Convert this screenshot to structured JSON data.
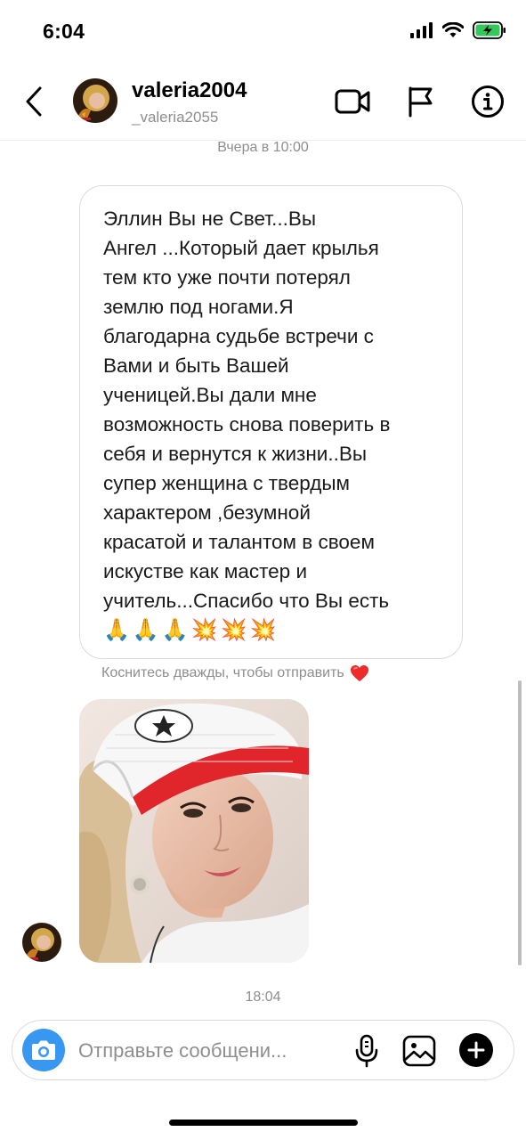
{
  "status_bar": {
    "time": "6:04",
    "icons": [
      "signal-icon",
      "wifi-icon",
      "battery-charging-icon"
    ],
    "battery_color": "#34c759"
  },
  "header": {
    "username": "valeria2004",
    "handle": "_valeria2055",
    "icons": [
      "back-chevron-icon",
      "video-call-icon",
      "flag-icon",
      "info-icon"
    ]
  },
  "thread": {
    "timestamp_top": "Вчера в 10:00",
    "message": {
      "text": "Эллин Вы не Свет...Вы\nАнгел ...Который дает крылья\nтем кто уже почти потерял\nземлю под ногами.Я\nблагодарна судьбе встречи с\nВами и быть Вашей\nученицей.Вы дали мне\nвозможность снова поверить в\nсебя и вернутся к жизни..Вы\nсупер женщина с твердым\nхарактером ,безумной\nкрасатой и талантом в своем\nискустве как мастер и\nучитель...Спасибо что Вы есть",
      "emojis": [
        "🙏",
        "🙏",
        "🙏",
        "💥",
        "💥",
        "💥"
      ]
    },
    "hint": "Коснитесь дважды, чтобы отправить",
    "hint_icon": "heart-icon",
    "photo_icon": "selfie-photo",
    "timestamp_bottom": "18:04"
  },
  "composer": {
    "placeholder": "Отправьте сообщени...",
    "value": "",
    "accent_color": "#3897f0",
    "icons": [
      "camera-icon",
      "microphone-icon",
      "gallery-icon",
      "plus-icon"
    ]
  }
}
